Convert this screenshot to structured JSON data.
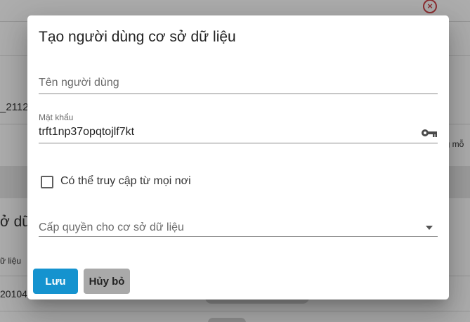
{
  "background": {
    "fragments": {
      "code_partial": "_2112",
      "text_right_partial": "ng mỗ",
      "heading_partial": "ở dữ",
      "column_partial": "ữ liệu",
      "row_partial": "20104"
    }
  },
  "dialog": {
    "title": "Tạo người dùng cơ sở dữ liệu",
    "username": {
      "placeholder": "Tên người dùng",
      "value": ""
    },
    "password": {
      "label": "Mật khẩu",
      "value": "trft1np37opqtojlf7kt",
      "icon": "key-icon"
    },
    "access_anywhere": {
      "label": "Có thể truy cập từ mọi nơi",
      "checked": false
    },
    "grant_db": {
      "placeholder": "Cấp quyền cho cơ sở dữ liệu",
      "icon": "dropdown-arrow-icon"
    },
    "buttons": {
      "save": "Lưu",
      "cancel": "Hủy bỏ"
    }
  },
  "colors": {
    "primary": "#1593cf",
    "secondary": "#a9a9a9",
    "danger": "#d0454b"
  }
}
